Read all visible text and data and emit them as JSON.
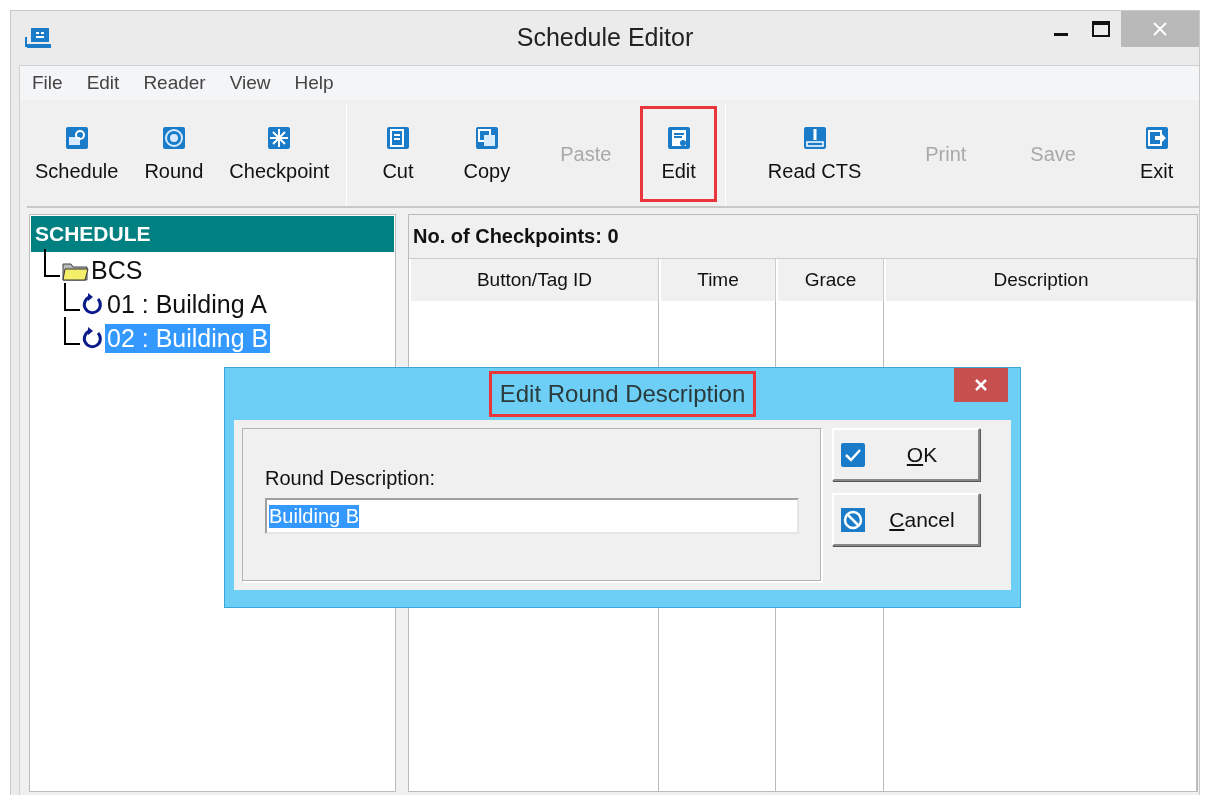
{
  "window": {
    "title": "Schedule Editor"
  },
  "menu": [
    "File",
    "Edit",
    "Reader",
    "View",
    "Help"
  ],
  "toolbar": [
    [
      {
        "label": "Schedule",
        "disabled": false,
        "highlighted": false
      },
      {
        "label": "Round",
        "disabled": false,
        "highlighted": false
      },
      {
        "label": "Checkpoint",
        "disabled": false,
        "highlighted": false
      }
    ],
    [
      {
        "label": "Cut",
        "disabled": false,
        "highlighted": false
      },
      {
        "label": "Copy",
        "disabled": false,
        "highlighted": false
      },
      {
        "label": "Paste",
        "disabled": true,
        "highlighted": false
      },
      {
        "label": "Edit",
        "disabled": false,
        "highlighted": true
      }
    ],
    [
      {
        "label": "Read CTS",
        "disabled": false,
        "highlighted": false
      },
      {
        "label": "Print",
        "disabled": true,
        "highlighted": false
      },
      {
        "label": "Save",
        "disabled": true,
        "highlighted": false
      },
      {
        "label": "Exit",
        "disabled": false,
        "highlighted": false
      }
    ]
  ],
  "tree": {
    "header": "SCHEDULE",
    "items": [
      {
        "label": "BCS",
        "kind": "folder",
        "selected": false,
        "children": [
          {
            "label": "01 : Building A",
            "kind": "round",
            "selected": false
          },
          {
            "label": "02 : Building B",
            "kind": "round",
            "selected": true
          }
        ]
      }
    ]
  },
  "grid": {
    "summary": "No. of Checkpoints: 0",
    "columns": [
      "Button/Tag ID",
      "Time",
      "Grace",
      "Description"
    ]
  },
  "dialog": {
    "title": "Edit Round Description",
    "title_highlighted": true,
    "field_label": "Round Description:",
    "value": "Building B",
    "value_selected": true,
    "buttons": [
      {
        "label": "OK",
        "kind": "ok"
      },
      {
        "label": "Cancel",
        "kind": "cancel"
      }
    ]
  }
}
